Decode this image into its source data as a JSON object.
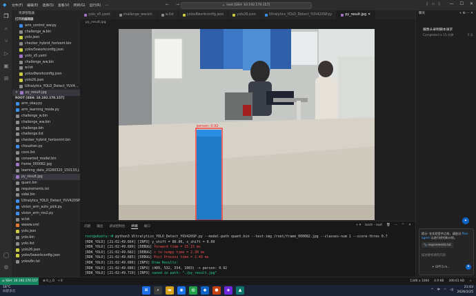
{
  "titlebar": {
    "menu": [
      "文件(F)",
      "编辑(E)",
      "选择(S)",
      "查看(V)",
      "转到(G)",
      "运行(R)",
      "…"
    ],
    "command_center": "root [SSH: 10.192.170.157]"
  },
  "sidebar": {
    "title": "资源管理器",
    "open_editors_header": "打开的编辑器",
    "open_editors": [
      {
        "name": "arm_control_ww.py",
        "closable": false
      },
      {
        "name": "challenge_w.bin",
        "closable": false
      },
      {
        "name": "yolo.json",
        "closable": false
      },
      {
        "name": "checker_hybrid_horizont.bin",
        "closable": false
      },
      {
        "name": "yolov5sworkconfig.json",
        "closable": false
      },
      {
        "name": "yolo_x5.yaml",
        "closable": false
      },
      {
        "name": "challenge_ww.bin",
        "closable": false
      },
      {
        "name": "w.list",
        "closable": false
      },
      {
        "name": "yolov8workconfig.json",
        "closable": false
      },
      {
        "name": "yolo26.json",
        "closable": false
      },
      {
        "name": "Ultralytics_YOLO_Detect_YUV4...",
        "closable": false
      },
      {
        "name": "py_result.jpg",
        "closable": true
      }
    ],
    "root_header": "ROOT [SSH: 10.192.170.157]",
    "tree": [
      "arm_okay.py",
      "arm_learning_mode.py",
      "challenge_w.bin",
      "challenge_ww.bin",
      "challenge.bin",
      "challenge.list",
      "checker_hybrid_horizontrt.bin",
      "chouzhen.py",
      "coco.list",
      "converted_model.bin",
      "frame_000082.jpg",
      "learning_data_20260320_150133.j...",
      "py_result.jpg",
      "quant.bin",
      "requirements.txt",
      "sidai.bin",
      "Ultralytics_YOLO_Detect_YUV420SP.py",
      "vision_arm_auto_pick.py",
      "vision_arm_ros2.py",
      "w.list",
      "wwww.xml",
      "yolo.json",
      "yolo.bin",
      "yolo.list",
      "yolo26.json",
      "yolov5sworkconfig.json",
      "yolov8n.txt"
    ]
  },
  "tabs": [
    {
      "label": "yolo_x5.yaml",
      "active": false
    },
    {
      "label": "challenge_ww.bin",
      "active": false
    },
    {
      "label": "w.list",
      "active": false
    },
    {
      "label": "yolov8workconfig.json",
      "active": false
    },
    {
      "label": "yolo26.json",
      "active": false
    },
    {
      "label": "Ultralytics_YOLO_Detect_YUV420SP.py",
      "active": false
    },
    {
      "label": "py_result.jpg",
      "active": true
    }
  ],
  "breadcrumb": "py_result.jpg",
  "image_overlay": {
    "label": "person: 0.92"
  },
  "panel": {
    "tabs": [
      "问题",
      "输出",
      "调试控制台",
      "终端",
      "端口"
    ],
    "active_tab": "终端",
    "terminal_name": "bash - root",
    "lines": [
      {
        "prompt": "root@ubuntu:~#",
        "text": " python3 Ultralytics_YOLO_Detect_YUV420SP.py --model-path quant.bin --test-img /root/frame_000082.jpg --classes-num 1 --score-thres 0.7"
      },
      {
        "prefix": "[RDK_YOLO] [21:02:49.664] [INFO] ",
        "text": "y_shift = 80.00, x_shift = 0.00",
        "color": "default"
      },
      {
        "prefix": "[RDK_YOLO] [21:02:49.680] [DEBUG] ",
        "text": "forward time = 15.15 ms",
        "color": "red"
      },
      {
        "prefix": "[RDK_YOLO] [21:02:49.682] [DEBUG] ",
        "text": "c to numpy time = 2.30 ms",
        "color": "red"
      },
      {
        "prefix": "[RDK_YOLO] [21:02:49.685] [DEBUG] ",
        "text": "Post Process time = 2.49 ms",
        "color": "red"
      },
      {
        "prefix": "[RDK_YOLO] [21:02:49.686] [INFO] ",
        "text": "Draw Results:",
        "color": "green"
      },
      {
        "prefix": "[RDK_YOLO] [21:02:49.686] [INFO] ",
        "text": "(409, 532, 554, 1003) -> person: 0.92",
        "color": "default"
      },
      {
        "prefix": "[RDK_YOLO] [21:02:49.719] [INFO] ",
        "text": "saved in path: \"./py_result.jpg\"",
        "color": "green"
      },
      {
        "prompt": "root@ubuntu:~#",
        "text": " "
      }
    ]
  },
  "chat": {
    "title": "聊天",
    "task_title": "摄像头录制脚本请求",
    "task_status": "Completed in 15 分钟",
    "task_age": "5 天",
    "hint_prefix": "提示: 在实验室中之前，请尝试",
    "hint_link": "Plan agent",
    "hint_suffix": " 以进行研究和计划。",
    "chip": "requirements.txt",
    "placeholder": "描述要构建的内容",
    "model": "GPT-5 m..."
  },
  "statusbar": {
    "remote": "SSH: 10.192.170.157",
    "left": [
      "⊗ 0 △ 0",
      "⑂ 0"
    ],
    "right": [
      "1346 x 1000",
      "4.9 KB",
      "300.61 KB",
      "☆"
    ]
  },
  "taskbar": {
    "weather_temp": "18°C",
    "weather_desc": "局部多云",
    "lang": "中",
    "time": "21:03",
    "date": "2026/3/25"
  },
  "colors": {
    "remote_bg": "#16825d",
    "accent": "#0e63c4",
    "terminal_red": "#f14c4c",
    "terminal_green": "#23d18b"
  }
}
